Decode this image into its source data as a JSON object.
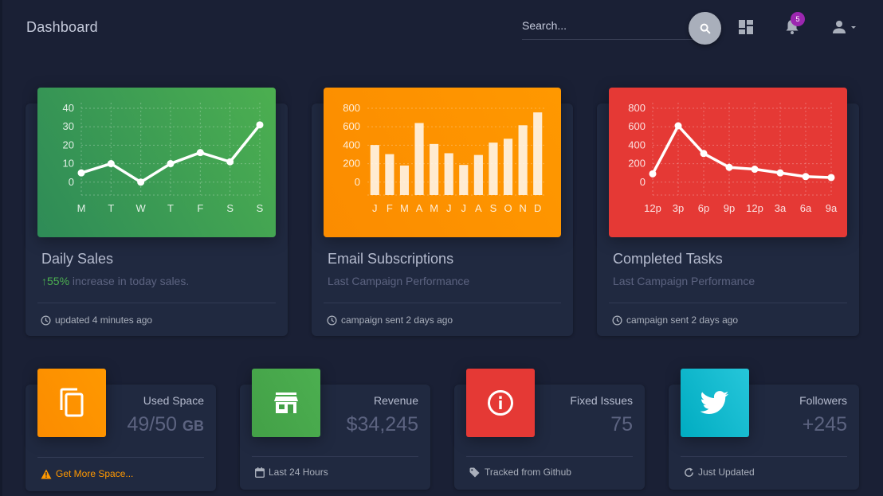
{
  "navbar": {
    "brand": "Dashboard",
    "search_placeholder": "Search...",
    "notification_count": "5"
  },
  "chart_cards": [
    {
      "title": "Daily Sales",
      "sub_percent": "55%",
      "sub_text": " increase in today sales.",
      "footer": "updated 4 minutes ago",
      "chart_data": {
        "type": "line",
        "categories": [
          "M",
          "T",
          "W",
          "T",
          "F",
          "S",
          "S"
        ],
        "values": [
          12,
          17,
          7,
          17,
          23,
          18,
          38
        ],
        "yticks": [
          "40",
          "30",
          "20",
          "10",
          "0"
        ],
        "ylim": [
          0,
          50
        ],
        "color": "#ffffff",
        "grid": true
      }
    },
    {
      "title": "Email Subscriptions",
      "sub_text": "Last Campaign Performance",
      "footer": "campaign sent 2 days ago",
      "chart_data": {
        "type": "bar",
        "categories": [
          "J",
          "F",
          "M",
          "A",
          "M",
          "J",
          "J",
          "A",
          "S",
          "O",
          "N",
          "D"
        ],
        "values": [
          542,
          443,
          320,
          780,
          553,
          453,
          326,
          434,
          568,
          610,
          756,
          895
        ],
        "yticks": [
          "800",
          "600",
          "400",
          "200",
          "0"
        ],
        "ylim": [
          0,
          1000
        ],
        "color": "#ffffff",
        "grid": true
      }
    },
    {
      "title": "Completed Tasks",
      "sub_text": "Last Campaign Performance",
      "footer": "campaign sent 2 days ago",
      "chart_data": {
        "type": "line",
        "categories": [
          "12p",
          "3p",
          "6p",
          "9p",
          "12p",
          "3a",
          "6a",
          "9a"
        ],
        "values": [
          230,
          750,
          450,
          300,
          280,
          240,
          200,
          190
        ],
        "yticks": [
          "800",
          "600",
          "400",
          "200",
          "0"
        ],
        "ylim": [
          0,
          1000
        ],
        "color": "#ffffff",
        "grid": true
      }
    }
  ],
  "stat_cards": [
    {
      "label": "Used Space",
      "value": "49/50",
      "unit": "GB",
      "footer": "Get More Space...",
      "icon": "copy-icon",
      "color": "#ff9800"
    },
    {
      "label": "Revenue",
      "value": "$34,245",
      "unit": "",
      "footer": "Last 24 Hours",
      "icon": "store-icon",
      "color": "#4caf50"
    },
    {
      "label": "Fixed Issues",
      "value": "75",
      "unit": "",
      "footer": "Tracked from Github",
      "icon": "info-icon",
      "color": "#e53935"
    },
    {
      "label": "Followers",
      "value": "+245",
      "unit": "",
      "footer": "Just Updated",
      "icon": "twitter-icon",
      "color": "#00acc1"
    }
  ]
}
